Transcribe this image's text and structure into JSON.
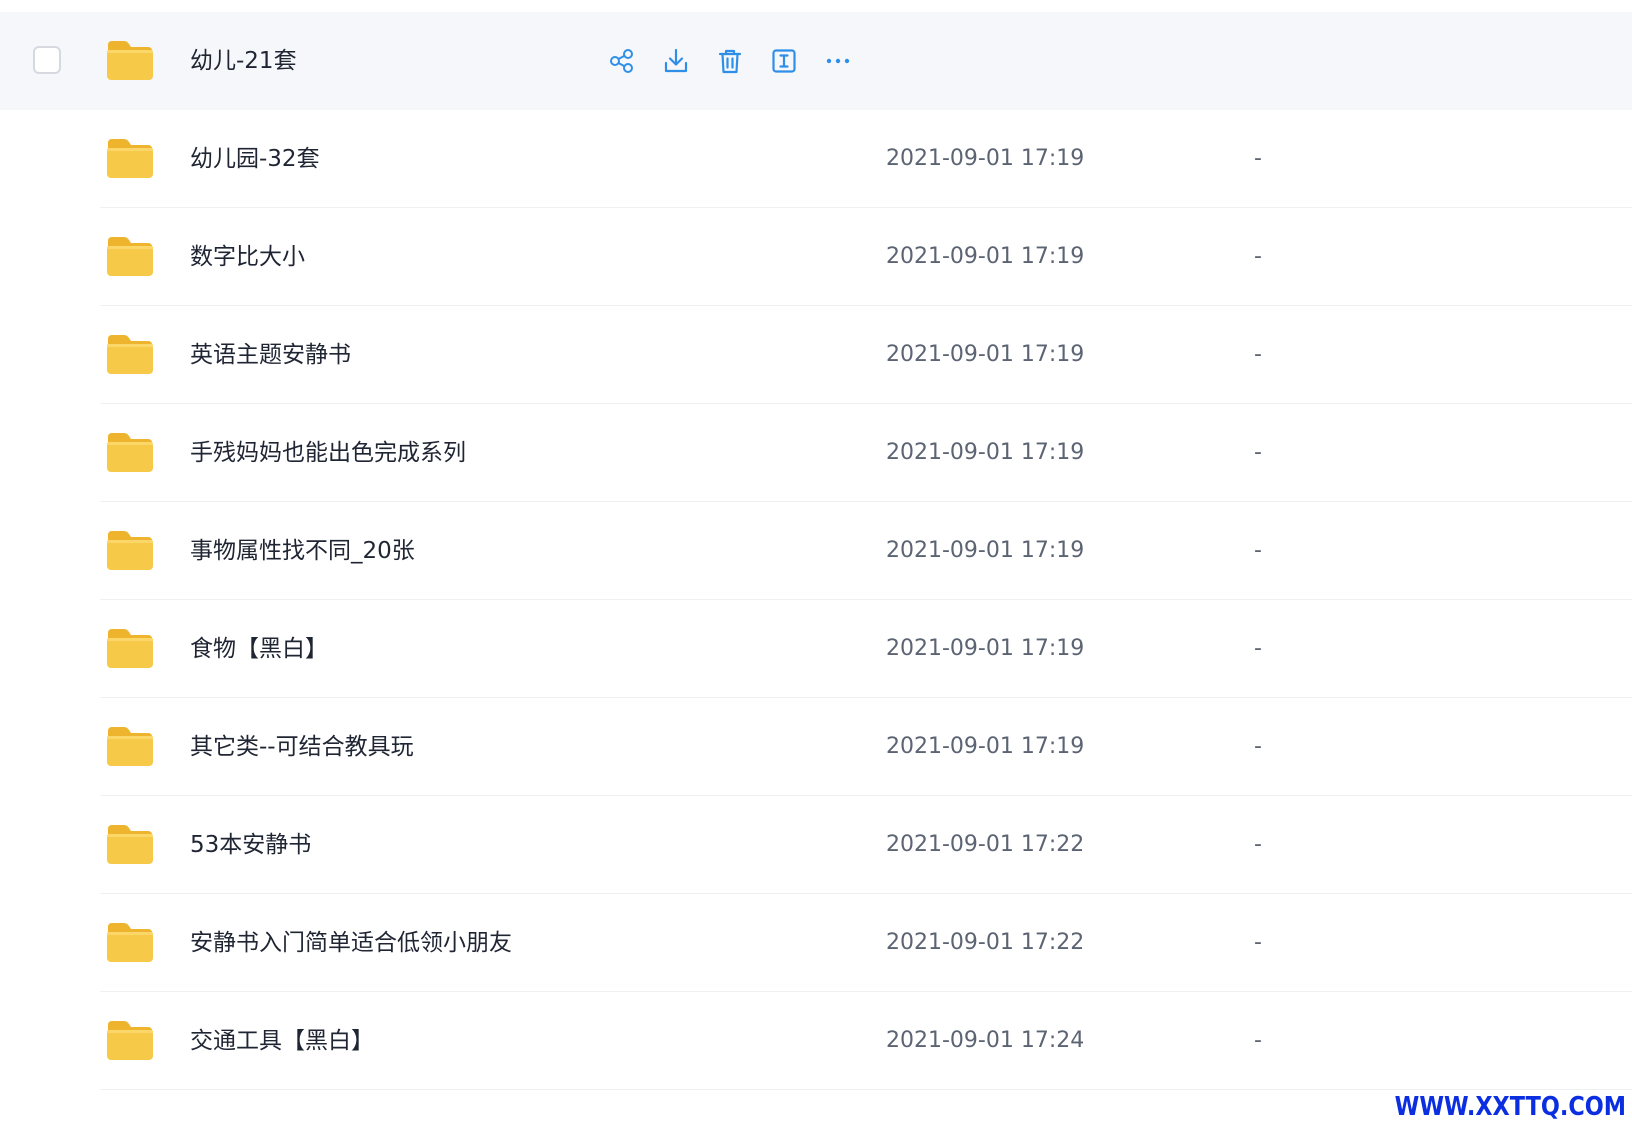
{
  "colors": {
    "accent": "#2f8fe8",
    "folder": "#f7c948",
    "folder_back": "#efb42e",
    "hover_row": "#f6f7fa",
    "watermark": "#0a2ee0"
  },
  "hovered_row": {
    "name": "幼儿-21套",
    "actions": [
      {
        "id": "share",
        "icon": "share-icon"
      },
      {
        "id": "download",
        "icon": "download-icon"
      },
      {
        "id": "delete",
        "icon": "trash-icon"
      },
      {
        "id": "rename",
        "icon": "rename-icon"
      },
      {
        "id": "more",
        "icon": "more-dots-icon"
      }
    ]
  },
  "files": [
    {
      "name": "幼儿园-32套",
      "modified": "2021-09-01 17:19",
      "size": "-"
    },
    {
      "name": "数字比大小",
      "modified": "2021-09-01 17:19",
      "size": "-"
    },
    {
      "name": "英语主题安静书",
      "modified": "2021-09-01 17:19",
      "size": "-"
    },
    {
      "name": "手残妈妈也能出色完成系列",
      "modified": "2021-09-01 17:19",
      "size": "-"
    },
    {
      "name": "事物属性找不同_20张",
      "modified": "2021-09-01 17:19",
      "size": "-"
    },
    {
      "name": "食物【黑白】",
      "modified": "2021-09-01 17:19",
      "size": "-"
    },
    {
      "name": "其它类--可结合教具玩",
      "modified": "2021-09-01 17:19",
      "size": "-"
    },
    {
      "name": "53本安静书",
      "modified": "2021-09-01 17:22",
      "size": "-"
    },
    {
      "name": "安静书入门简单适合低领小朋友",
      "modified": "2021-09-01 17:22",
      "size": "-"
    },
    {
      "name": "交通工具【黑白】",
      "modified": "2021-09-01 17:24",
      "size": "-"
    }
  ],
  "watermark": {
    "text": "WWW.XXTTQ.COM"
  }
}
